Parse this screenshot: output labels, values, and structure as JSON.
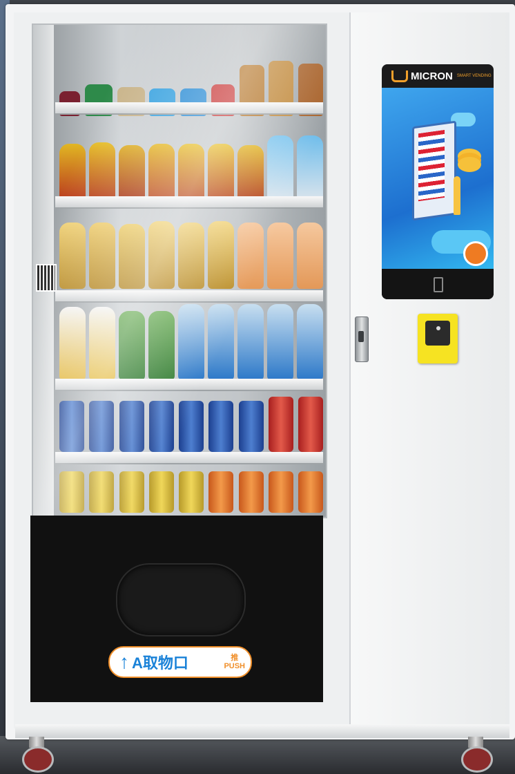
{
  "machine": {
    "brand": "MICRON",
    "brand_tag": "SMART VENDING",
    "pickup_label": "A取物口",
    "push_label_cn": "推",
    "push_label_en": "PUSH"
  },
  "colors": {
    "machine_body": "#f3f4f5",
    "pickup_area": "#111111",
    "screen_blue": "#1d6fcf",
    "label_blue": "#1a82d8",
    "label_orange": "#f08f2a",
    "card_reader": "#f6e322"
  },
  "icons": {
    "pickup_arrow": "↑",
    "logo": "micron-logo-icon"
  }
}
